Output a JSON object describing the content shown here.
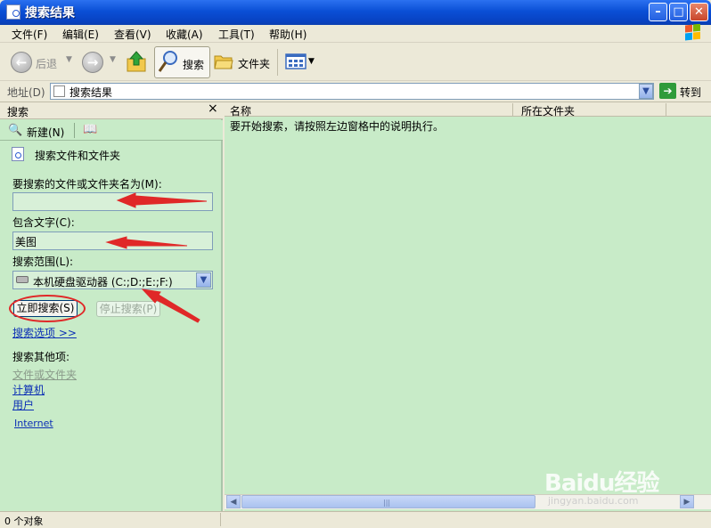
{
  "window": {
    "title": "搜索结果"
  },
  "menu": [
    "文件(F)",
    "编辑(E)",
    "查看(V)",
    "收藏(A)",
    "工具(T)",
    "帮助(H)"
  ],
  "toolbar": {
    "back": "后退",
    "search": "搜索",
    "folders": "文件夹"
  },
  "address": {
    "label": "地址(D)",
    "value": "搜索结果",
    "go": "转到"
  },
  "search_pane": {
    "title": "搜索",
    "close": "×",
    "new_label": "新建(N)",
    "heading": "搜索文件和文件夹",
    "name_label": "要搜索的文件或文件夹名为(M):",
    "name_value": "",
    "text_label": "包含文字(C):",
    "text_value": "美图",
    "range_label": "搜索范围(L):",
    "range_value": "本机硬盘驱动器 (C:;D:;E:;F:)",
    "search_now": "立即搜索(S)",
    "stop_search": "停止搜索(P)",
    "options_link": "搜索选项 >>",
    "other_heading": "搜索其他项:",
    "other_items": [
      "文件或文件夹",
      "计算机",
      "用户"
    ],
    "internet": "Internet"
  },
  "results": {
    "columns": [
      "名称",
      "所在文件夹"
    ],
    "message": "要开始搜索，请按照左边窗格中的说明执行。"
  },
  "status": {
    "text": "0 个对象"
  },
  "watermark": {
    "logo": "Baidu经验",
    "sub": "jingyan.baidu.com"
  },
  "colors": {
    "pane_bg": "#c8ebc8",
    "title_blue": "#0a4fd6",
    "annotation_red": "#e02828",
    "link": "#0c2fb5"
  }
}
